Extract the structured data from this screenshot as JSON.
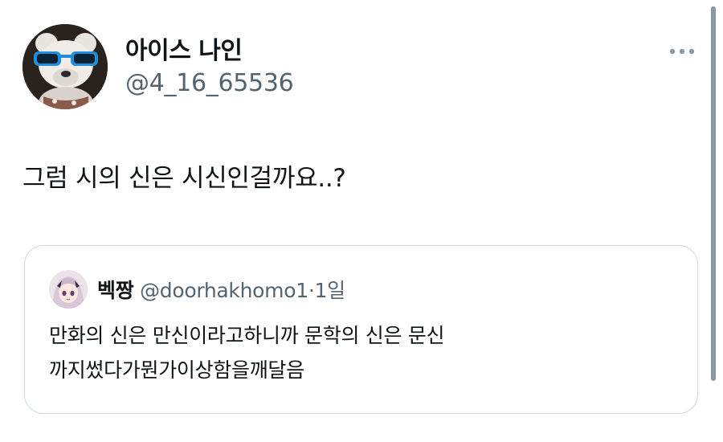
{
  "tweet": {
    "author": {
      "display_name": "아이스 나인",
      "handle": "@4_16_65536"
    },
    "text": "그럼 시의 신은 시신인걸까요..?",
    "more_icon": "ellipsis-icon",
    "quoted": {
      "author": {
        "display_name": "벡짱",
        "handle": "@doorhakhomo1"
      },
      "separator": "·",
      "time": "1일",
      "text_lines": [
        "만화의 신은 만신이라고하니까 문학의 신은 문신",
        "까지썼다가뭔가이상함을깨달음"
      ]
    }
  },
  "colors": {
    "text_primary": "#0f1419",
    "text_secondary": "#536471",
    "border": "#cfd9de",
    "scrollbar": "#8b98a5"
  }
}
